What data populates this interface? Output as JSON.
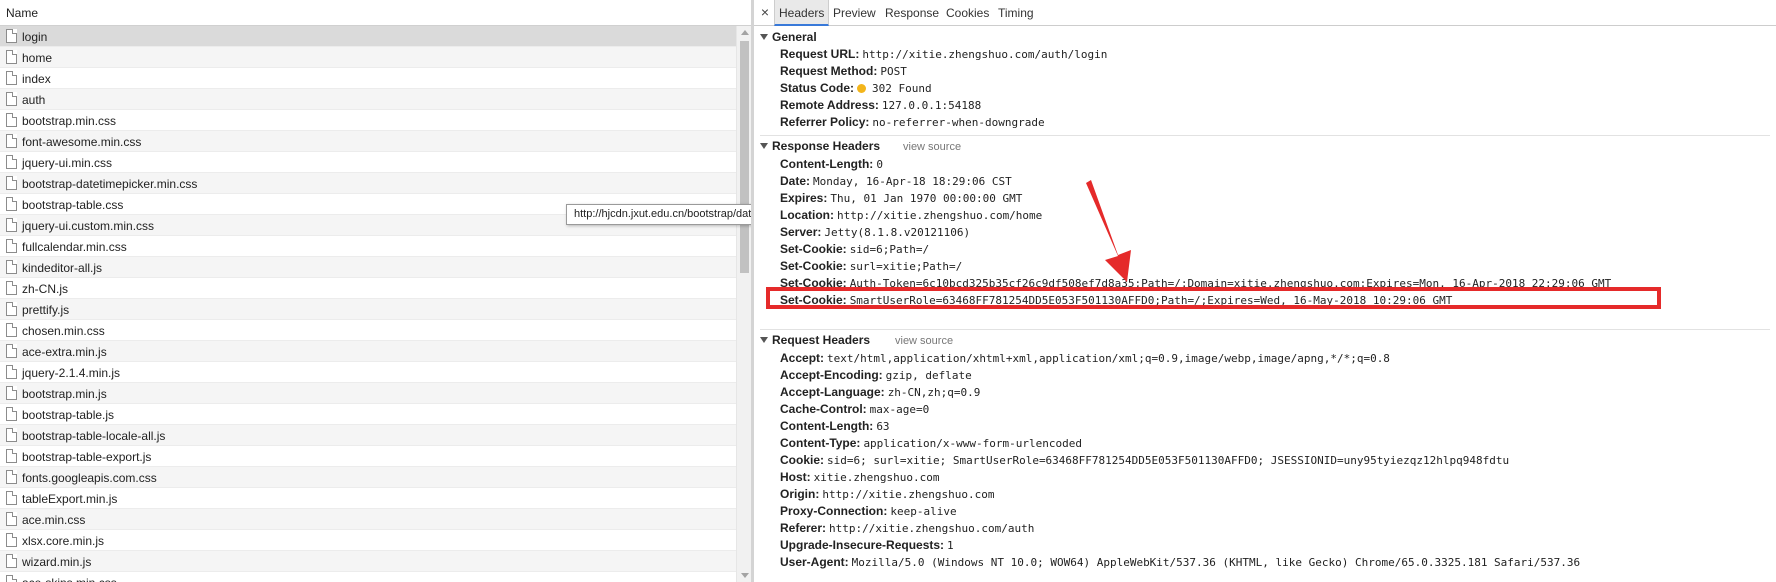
{
  "list": {
    "header": "Name",
    "items": [
      "login",
      "home",
      "index",
      "auth",
      "bootstrap.min.css",
      "font-awesome.min.css",
      "jquery-ui.min.css",
      "bootstrap-datetimepicker.min.css",
      "bootstrap-table.css",
      "jquery-ui.custom.min.css",
      "fullcalendar.min.css",
      "kindeditor-all.js",
      "zh-CN.js",
      "prettify.js",
      "chosen.min.css",
      "ace-extra.min.js",
      "jquery-2.1.4.min.js",
      "bootstrap.min.js",
      "bootstrap-table.js",
      "bootstrap-table-locale-all.js",
      "bootstrap-table-export.js",
      "fonts.googleapis.com.css",
      "tableExport.min.js",
      "ace.min.css",
      "xlsx.core.min.js",
      "wizard.min.js",
      "ace-skins.min.css"
    ],
    "selected_index": 0,
    "tooltip": "http://hjcdn.jxut.edu.cn/bootstrap/datetime/css/bootstrap-datetimepicker.min.css"
  },
  "tabs": {
    "close": "×",
    "headers": "Headers",
    "preview": "Preview",
    "response": "Response",
    "cookies": "Cookies",
    "timing": "Timing",
    "active": "Headers"
  },
  "general": {
    "title": "General",
    "rows": [
      {
        "k": "Request URL:",
        "v": "http://xitie.zhengshuo.com/auth/login"
      },
      {
        "k": "Request Method:",
        "v": "POST"
      },
      {
        "k": "Status Code:",
        "v": "302 Found"
      },
      {
        "k": "Remote Address:",
        "v": "127.0.0.1:54188"
      },
      {
        "k": "Referrer Policy:",
        "v": "no-referrer-when-downgrade"
      }
    ],
    "status_color": "#f3b51b"
  },
  "response_headers": {
    "title": "Response Headers",
    "view_source": "view source",
    "rows": [
      {
        "k": "Content-Length:",
        "v": "0"
      },
      {
        "k": "Date:",
        "v": "Monday, 16-Apr-18 18:29:06 CST"
      },
      {
        "k": "Expires:",
        "v": "Thu, 01 Jan 1970 00:00:00 GMT"
      },
      {
        "k": "Location:",
        "v": "http://xitie.zhengshuo.com/home"
      },
      {
        "k": "Server:",
        "v": "Jetty(8.1.8.v20121106)"
      },
      {
        "k": "Set-Cookie:",
        "v": "sid=6;Path=/"
      },
      {
        "k": "Set-Cookie:",
        "v": "surl=xitie;Path=/"
      },
      {
        "k": "Set-Cookie:",
        "v": "Auth-Token=6c10bcd325b35cf26c9df508ef7d8a35;Path=/;Domain=xitie.zhengshuo.com;Expires=Mon, 16-Apr-2018 22:29:06 GMT"
      },
      {
        "k": "Set-Cookie:",
        "v": "SmartUserRole=63468FF781254DD5E053F501130AFFD0;Path=/;Expires=Wed, 16-May-2018 10:29:06 GMT"
      }
    ]
  },
  "request_headers": {
    "title": "Request Headers",
    "view_source": "view source",
    "rows": [
      {
        "k": "Accept:",
        "v": "text/html,application/xhtml+xml,application/xml;q=0.9,image/webp,image/apng,*/*;q=0.8"
      },
      {
        "k": "Accept-Encoding:",
        "v": "gzip, deflate"
      },
      {
        "k": "Accept-Language:",
        "v": "zh-CN,zh;q=0.9"
      },
      {
        "k": "Cache-Control:",
        "v": "max-age=0"
      },
      {
        "k": "Content-Length:",
        "v": "63"
      },
      {
        "k": "Content-Type:",
        "v": "application/x-www-form-urlencoded"
      },
      {
        "k": "Cookie:",
        "v": "sid=6; surl=xitie; SmartUserRole=63468FF781254DD5E053F501130AFFD0; JSESSIONID=uny95tyiezqz12hlpq948fdtu"
      },
      {
        "k": "Host:",
        "v": "xitie.zhengshuo.com"
      },
      {
        "k": "Origin:",
        "v": "http://xitie.zhengshuo.com"
      },
      {
        "k": "Proxy-Connection:",
        "v": "keep-alive"
      },
      {
        "k": "Referer:",
        "v": "http://xitie.zhengshuo.com/auth"
      },
      {
        "k": "Upgrade-Insecure-Requests:",
        "v": "1"
      },
      {
        "k": "User-Agent:",
        "v": "Mozilla/5.0 (Windows NT 10.0; WOW64) AppleWebKit/537.36 (KHTML, like Gecko) Chrome/65.0.3325.181 Safari/537.36"
      }
    ]
  },
  "annotation": {
    "color": "#e52a2a"
  }
}
